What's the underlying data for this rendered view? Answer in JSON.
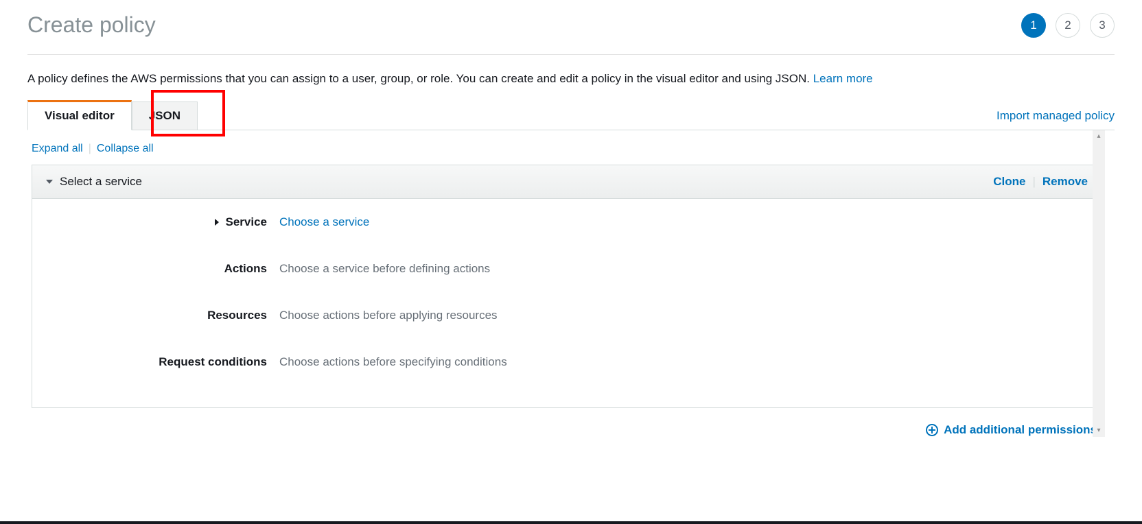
{
  "header": {
    "title": "Create policy",
    "steps": [
      "1",
      "2",
      "3"
    ],
    "active_step": 0
  },
  "intro": {
    "text": "A policy defines the AWS permissions that you can assign to a user, group, or role. You can create and edit a policy in the visual editor and using JSON. ",
    "learn_more": "Learn more"
  },
  "tabs": {
    "visual_editor": "Visual editor",
    "json": "JSON",
    "import_link": "Import managed policy"
  },
  "toolbar": {
    "expand_all": "Expand all",
    "collapse_all": "Collapse all"
  },
  "panel": {
    "title": "Select a service",
    "clone": "Clone",
    "remove": "Remove"
  },
  "rows": {
    "service": {
      "label": "Service",
      "value": "Choose a service"
    },
    "actions": {
      "label": "Actions",
      "value": "Choose a service before defining actions"
    },
    "resources": {
      "label": "Resources",
      "value": "Choose actions before applying resources"
    },
    "conditions": {
      "label": "Request conditions",
      "value": "Choose actions before specifying conditions"
    }
  },
  "footer": {
    "add_permissions": "Add additional permissions"
  }
}
